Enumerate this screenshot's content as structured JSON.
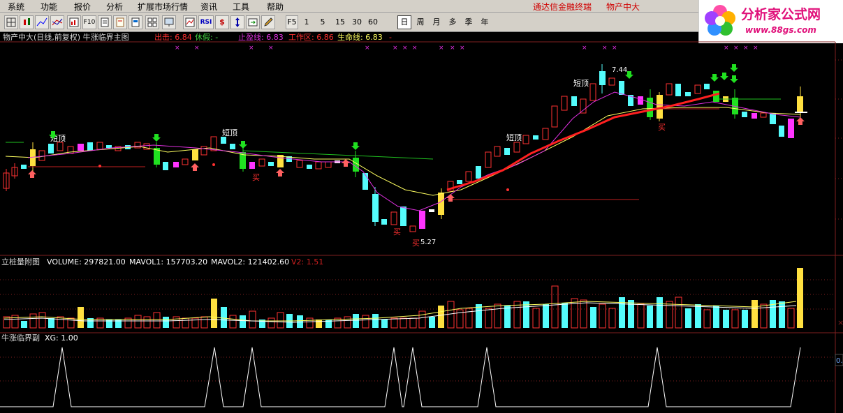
{
  "menu": [
    "系统",
    "功能",
    "报价",
    "分析",
    "扩展市场行情",
    "资讯",
    "工具",
    "帮助"
  ],
  "brand": {
    "left": "通达信金融终端",
    "right": "物产中大"
  },
  "toolbar": {
    "periods": [
      "F5",
      "1",
      "5",
      "15",
      "30",
      "60",
      "日",
      "周",
      "月",
      "多",
      "季",
      "年"
    ],
    "selected_period": "日",
    "icons": [
      "grid-icon",
      "candle-icon",
      "line-icon",
      "compare-icon",
      "f10-icon",
      "doc-icon",
      "info-icon",
      "page-icon",
      "rsi-icon",
      "dollar-icon",
      "drag-icon",
      "window-icon",
      "pencil-icon"
    ],
    "rsi_label": "RSI"
  },
  "logo": {
    "title": "分析家公式网",
    "url": "www.88gs.com"
  },
  "main_panel": {
    "title": "物产中大(日线,前复权) 牛涨临界主图",
    "indicators": [
      {
        "label": "出击: 6.84",
        "color": "#ff3030"
      },
      {
        "label": "休假: -",
        "color": "#40d040"
      },
      {
        "label": "止盈线: 6.83",
        "color": "#e030e0"
      },
      {
        "label": "工作区: 6.86",
        "color": "#ff3030"
      },
      {
        "label": "生命线: 6.83",
        "color": "#ffff60"
      }
    ],
    "dash": "-",
    "annotations": {
      "high": "7.44",
      "low": "5.27",
      "short_top": "短顶",
      "buy": "买"
    }
  },
  "volume_panel": {
    "title": "立桩量附图",
    "indicators": [
      {
        "label": "VOLUME: 297821.00",
        "color": "#ffffff"
      },
      {
        "label": "MAVOL1: 157703.20",
        "color": "#ffffff"
      },
      {
        "label": "MAVOL2: 121402.60",
        "color": "#ffffff"
      },
      {
        "label": "V2: 1.51",
        "color": "#d02020"
      }
    ]
  },
  "xg_panel": {
    "title": "牛涨临界副",
    "indicator": "XG: 1.00",
    "right_value": "0."
  },
  "colors": {
    "up": "#ff3232",
    "down": "#54fcfc",
    "hot": "#ff34ff",
    "gold": "#ffe040",
    "green": "#20e020"
  }
}
